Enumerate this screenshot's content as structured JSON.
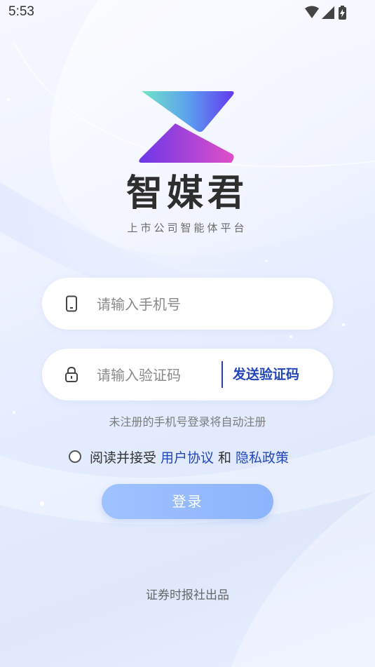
{
  "status_bar": {
    "time": "5:53",
    "icons": [
      "wifi-icon",
      "signal-icon",
      "battery-charging-icon"
    ]
  },
  "brand": {
    "name": "智媒君",
    "slogan": "上市公司智能体平台",
    "colors": {
      "teal": "#6fe0c8",
      "purple": "#6b3df0",
      "magenta": "#e24cc4"
    }
  },
  "form": {
    "phone": {
      "placeholder": "请输入手机号",
      "value": "",
      "icon": "phone-icon"
    },
    "code": {
      "placeholder": "请输入验证码",
      "value": "",
      "icon": "lock-icon",
      "send_label": "发送验证码"
    },
    "hint": "未注册的手机号登录将自动注册",
    "agreement": {
      "prefix": "阅读并接受",
      "user_agreement": "用户协议",
      "and": "和",
      "privacy_policy": "隐私政策",
      "checked": false
    },
    "login_label": "登录"
  },
  "footer": "证券时报社出品",
  "colors": {
    "accent": "#2347b8",
    "button": "#9fc2ff"
  }
}
